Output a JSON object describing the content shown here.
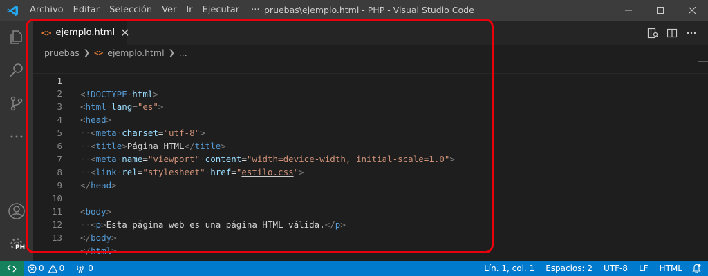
{
  "menu": [
    "Archivo",
    "Editar",
    "Selección",
    "Ver",
    "Ir",
    "Ejecutar"
  ],
  "menu_more": "···",
  "window_title": "pruebas\\ejemplo.html - PHP - Visual Studio Code",
  "tab": {
    "icon": "<>",
    "label": "ejemplo.html",
    "close": "✕"
  },
  "breadcrumb": {
    "folder": "pruebas",
    "file": "ejemplo.html",
    "more": "..."
  },
  "activity_badge": "PH",
  "code": {
    "l1": "1",
    "l2": "2",
    "l3": "3",
    "l4": "4",
    "l5": "5",
    "l6": "6",
    "l7": "7",
    "l8": "8",
    "l9": "9",
    "l10": "10",
    "l11": "11",
    "l12": "12",
    "l13": "13",
    "doctype": "!DOCTYPE",
    "html": "html",
    "head": "head",
    "meta": "meta",
    "title": "title",
    "link": "link",
    "body": "body",
    "p": "p",
    "lang": "lang",
    "es": "\"es\"",
    "charset": "charset",
    "utf8": "\"utf-8\"",
    "title_text": "Página HTML",
    "name": "name",
    "viewport": "\"viewport\"",
    "content": "content",
    "content_val": "\"width=device-width, initial-scale=1.0\"",
    "rel": "rel",
    "stylesheet": "\"stylesheet\"",
    "href": "href",
    "href_val": "estilo.css",
    "p_text": "Esta página web es una página HTML válida."
  },
  "status": {
    "errors": "0",
    "warnings": "0",
    "ports": "0",
    "position": "Lín. 1, col. 1",
    "spaces": "Espacios: 2",
    "encoding": "UTF-8",
    "eol": "LF",
    "language": "HTML"
  },
  "colors": {
    "accent": "#007acc",
    "highlight": "#e8000b",
    "tag": "#569cd6",
    "attr": "#9cdcfe",
    "string": "#ce9178"
  }
}
